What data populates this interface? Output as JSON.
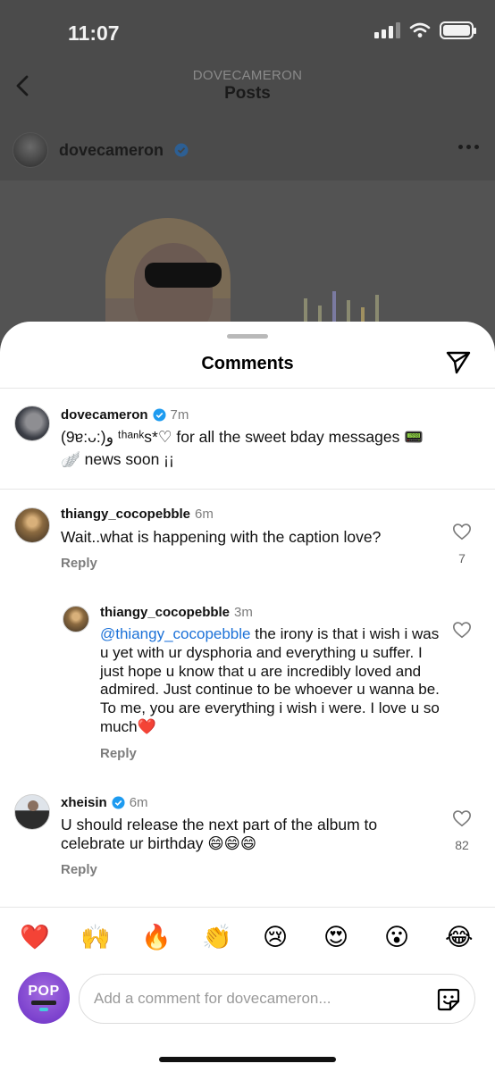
{
  "status_bar": {
    "time": "11:07"
  },
  "header": {
    "username": "DOVECAMERON",
    "title": "Posts"
  },
  "post": {
    "username": "dovecameron"
  },
  "sheet": {
    "title": "Comments"
  },
  "comments": [
    {
      "username": "dovecameron",
      "time": "7m",
      "text_line1": "(9ɐ:ᴗ:)ﻭ ᵗʰᵃⁿᵏs*♡ for all the sweet bday messages 📟",
      "text_line2": "🪽 news soon ¡¡"
    },
    {
      "username": "thiangy_cocopebble",
      "time": "6m",
      "text": "Wait..what is happening with the caption love?",
      "reply_label": "Reply",
      "likes": "7"
    },
    {
      "username": "thiangy_cocopebble",
      "time": "3m",
      "mention": "@thiangy_cocopebble",
      "text": " the irony is that i wish i was u yet with ur dysphoria and everything u suffer. I just hope u know that u are incredibly loved and admired. Just continue to be whoever u wanna be. To me, you are everything i wish i were. I love u so much❤️",
      "reply_label": "Reply"
    },
    {
      "username": "xheisin",
      "time": "6m",
      "text": "U should release the next part of the album to celebrate ur birthday 😄😄😄",
      "reply_label": "Reply",
      "likes": "82"
    }
  ],
  "emoji_bar": [
    "❤️",
    "🙌",
    "🔥",
    "👏",
    "😢",
    "😍",
    "😮",
    "😂"
  ],
  "composer": {
    "placeholder": "Add a comment for dovecameron...",
    "avatar_text": "POP"
  },
  "colors": {
    "accent": "#1d72d8",
    "verified": "#1d9bf0"
  },
  "icons": [
    "back-chevron-icon",
    "more-dots-icon",
    "verified-badge-icon",
    "send-icon",
    "heart-outline-icon",
    "sticker-icon"
  ]
}
